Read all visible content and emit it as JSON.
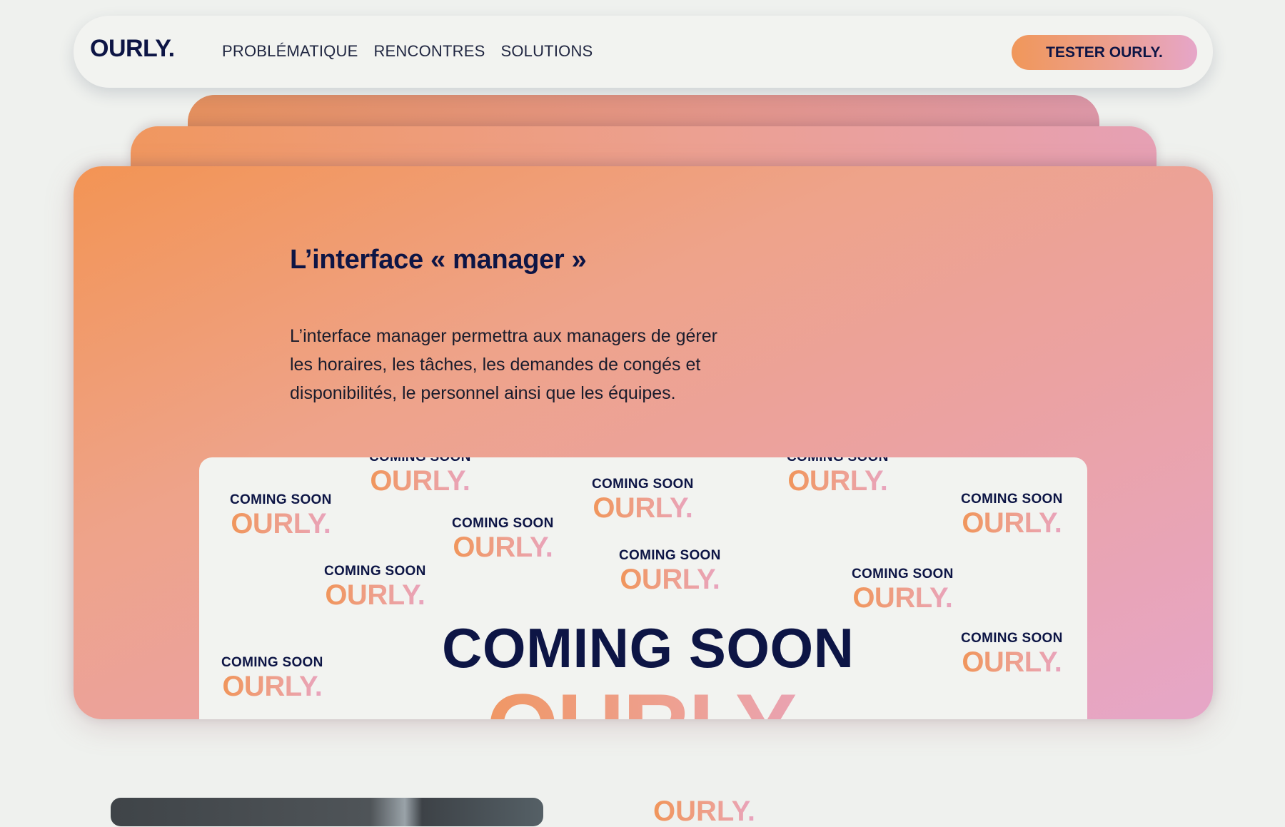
{
  "nav": {
    "logo": "OURLY.",
    "links": [
      "PROBLÉMATIQUE",
      "RENCONTRES",
      "SOLUTIONS"
    ],
    "cta_label": "TESTER OURLY."
  },
  "card": {
    "title": "L’interface « manager »",
    "description": "L’interface manager permettra aux managers de gérer les horaires, les tâches, les demandes de congés et disponibilités, le personnel ainsi que les équipes."
  },
  "preview": {
    "coming_soon": "COMING SOON",
    "brand": "OURLY."
  },
  "bottom": {
    "brand": "OURLY."
  },
  "colors": {
    "navy": "#0d1545",
    "orange": "#f39454",
    "pink": "#e6a6c8",
    "background": "#eff1ee"
  }
}
